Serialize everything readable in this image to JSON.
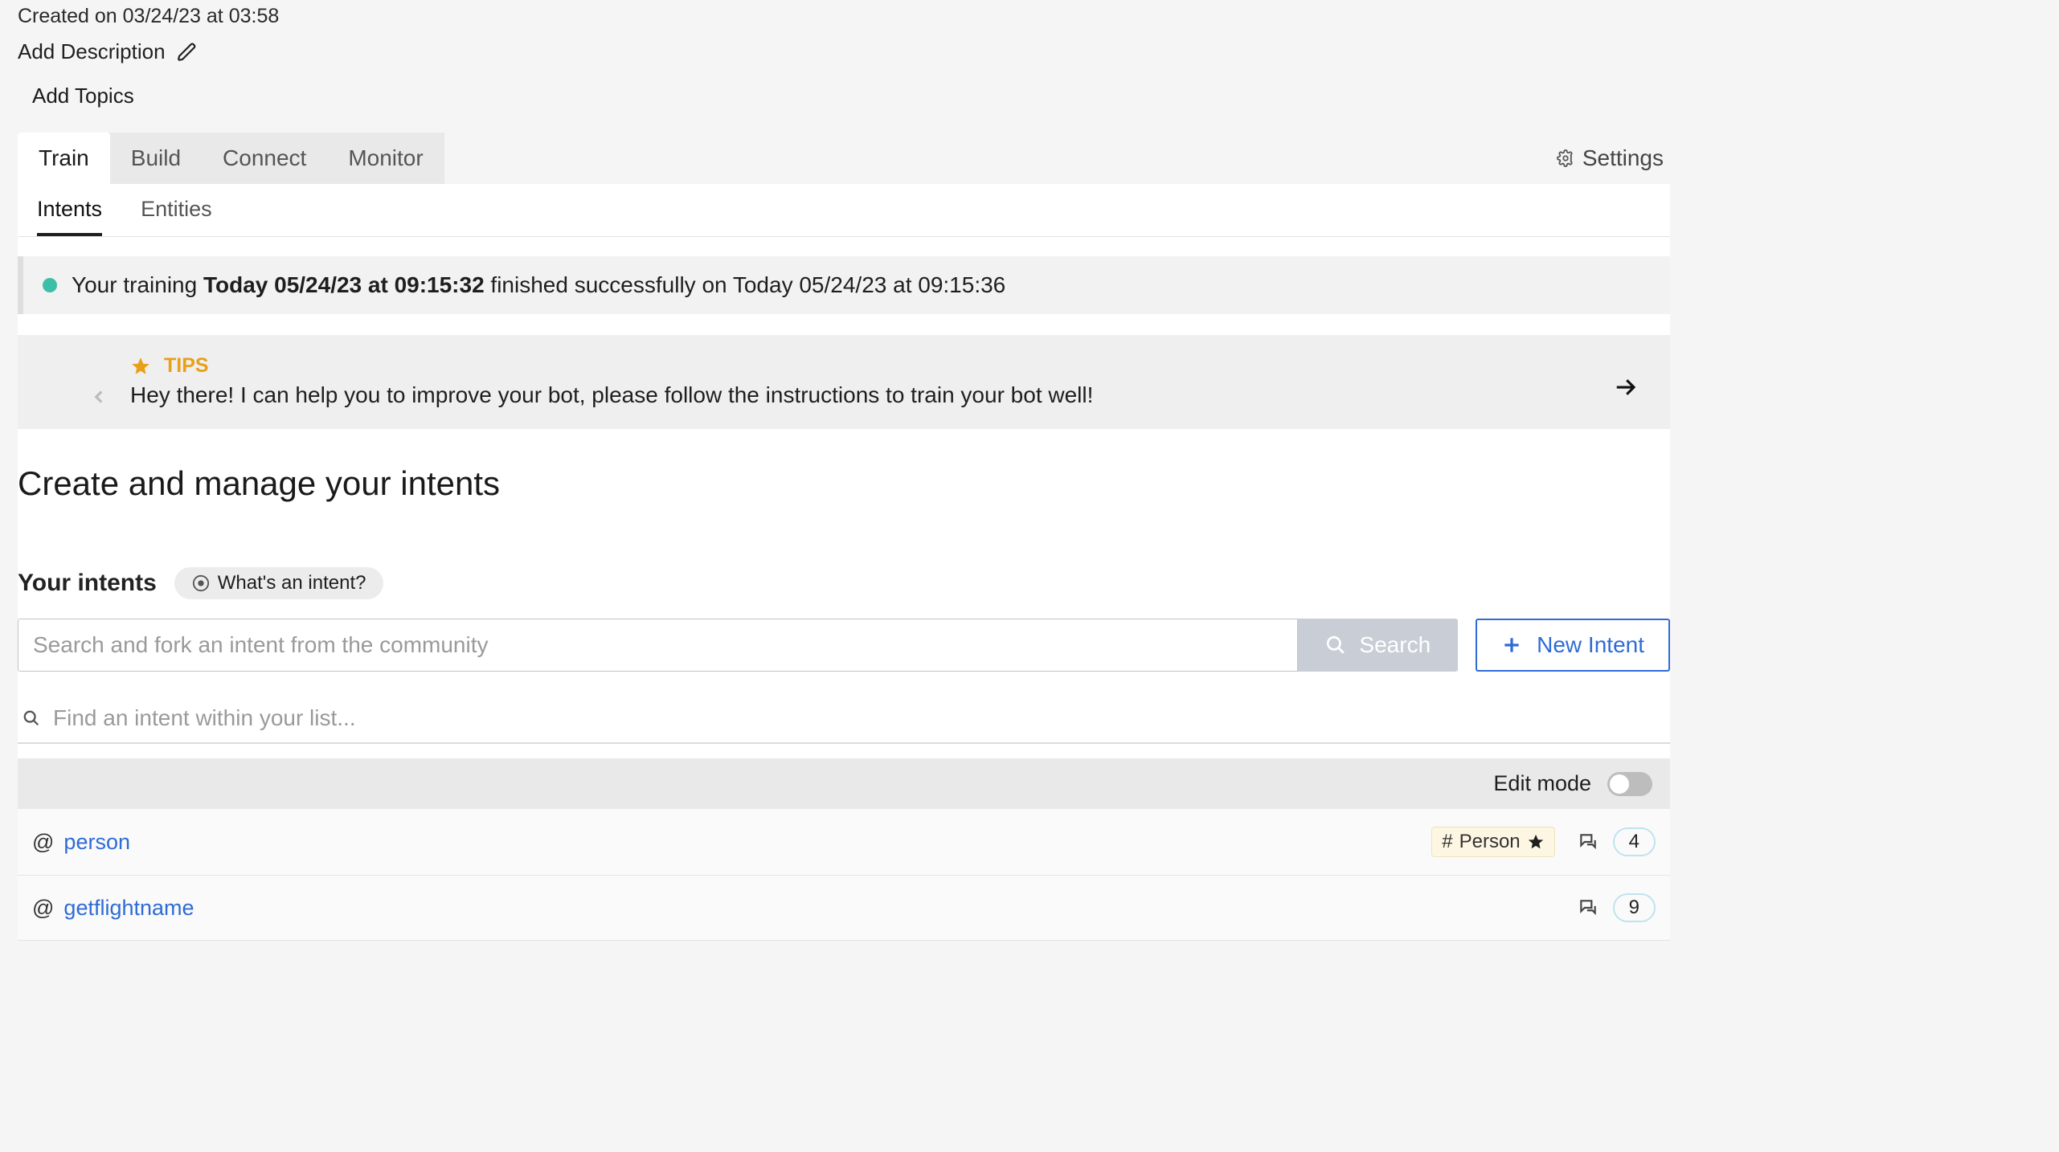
{
  "meta": {
    "created_on": "Created on 03/24/23 at 03:58",
    "add_description": "Add Description",
    "add_topics": "Add Topics"
  },
  "tabs": {
    "items": [
      "Train",
      "Build",
      "Connect",
      "Monitor"
    ],
    "active_index": 0,
    "settings_label": "Settings"
  },
  "subtabs": {
    "items": [
      "Intents",
      "Entities"
    ],
    "active_index": 0
  },
  "status": {
    "prefix": "Your training ",
    "bold": "Today 05/24/23 at 09:15:32",
    "suffix": " finished successfully on Today 05/24/23 at 09:15:36"
  },
  "tips": {
    "heading": "TIPS",
    "text": "Hey there! I can help you to improve your bot, please follow the instructions to train your bot well!"
  },
  "section_title": "Create and manage your intents",
  "your_intents": {
    "label": "Your intents",
    "help_label": "What's an intent?"
  },
  "search": {
    "community_placeholder": "Search and fork an intent from the community",
    "search_label": "Search",
    "new_intent_label": "New Intent",
    "filter_placeholder": "Find an intent within your list..."
  },
  "edit_mode": {
    "label": "Edit mode",
    "on": false
  },
  "intents": [
    {
      "name": "person",
      "tag": "Person",
      "has_tag": true,
      "count": 4
    },
    {
      "name": "getflightname",
      "tag": "",
      "has_tag": false,
      "count": 9
    }
  ],
  "colors": {
    "accent_blue": "#2f6bd6",
    "status_dot": "#3cbfa6",
    "tip_gold": "#e8a018"
  }
}
